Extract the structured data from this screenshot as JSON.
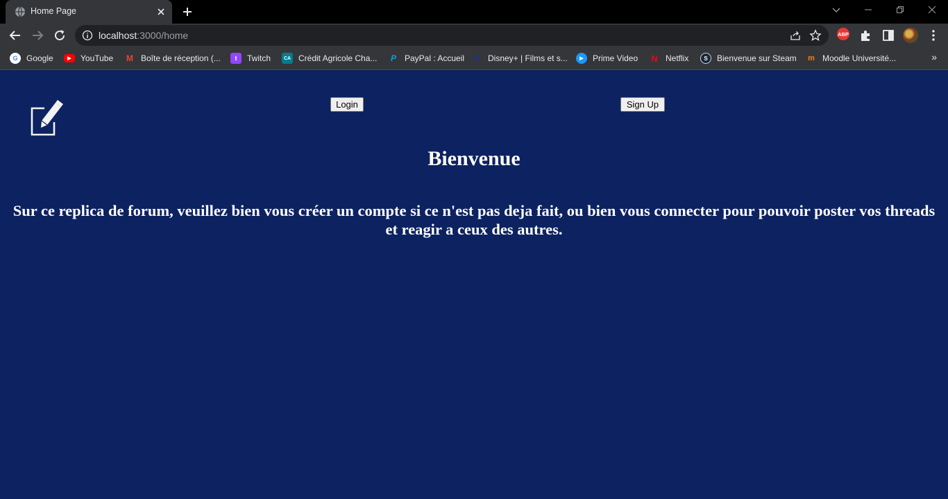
{
  "browser": {
    "tab": {
      "title": "Home Page",
      "favicon": "globe-icon"
    },
    "url": {
      "host": "localhost",
      "path": ":3000/home"
    },
    "bookmarks": [
      {
        "label": "Google",
        "icon": "google-icon",
        "color": "#ffffff"
      },
      {
        "label": "YouTube",
        "icon": "youtube-icon",
        "color": "#ff0000"
      },
      {
        "label": "Boîte de réception (...",
        "icon": "gmail-icon",
        "color": "#ea4335"
      },
      {
        "label": "Twitch",
        "icon": "twitch-icon",
        "color": "#9146ff"
      },
      {
        "label": "Crédit Agricole Cha...",
        "icon": "credit-agricole-icon",
        "color": "#007d8f"
      },
      {
        "label": "PayPal : Accueil",
        "icon": "paypal-icon",
        "color": "#003087"
      },
      {
        "label": "Disney+ | Films et s...",
        "icon": "disney-icon",
        "color": "#1a2d9e"
      },
      {
        "label": "Prime Video",
        "icon": "prime-video-icon",
        "color": "#1a98ff"
      },
      {
        "label": "Netflix",
        "icon": "netflix-icon",
        "color": "#e50914"
      },
      {
        "label": "Bienvenue sur Steam",
        "icon": "steam-icon",
        "color": "#1b2838"
      },
      {
        "label": "Moodle Université...",
        "icon": "moodle-icon",
        "color": "#f98012"
      }
    ],
    "extension_abp": "ABP"
  },
  "page": {
    "background": "#0d2260",
    "logo": "edit-note-icon",
    "login_label": "Login",
    "signup_label": "Sign Up",
    "heading": "Bienvenue",
    "subtext": "Sur ce replica de forum, veuillez bien vous créer un compte si ce n'est pas deja fait, ou bien vous connecter pour pouvoir poster vos threads et reagir a ceux des autres."
  }
}
